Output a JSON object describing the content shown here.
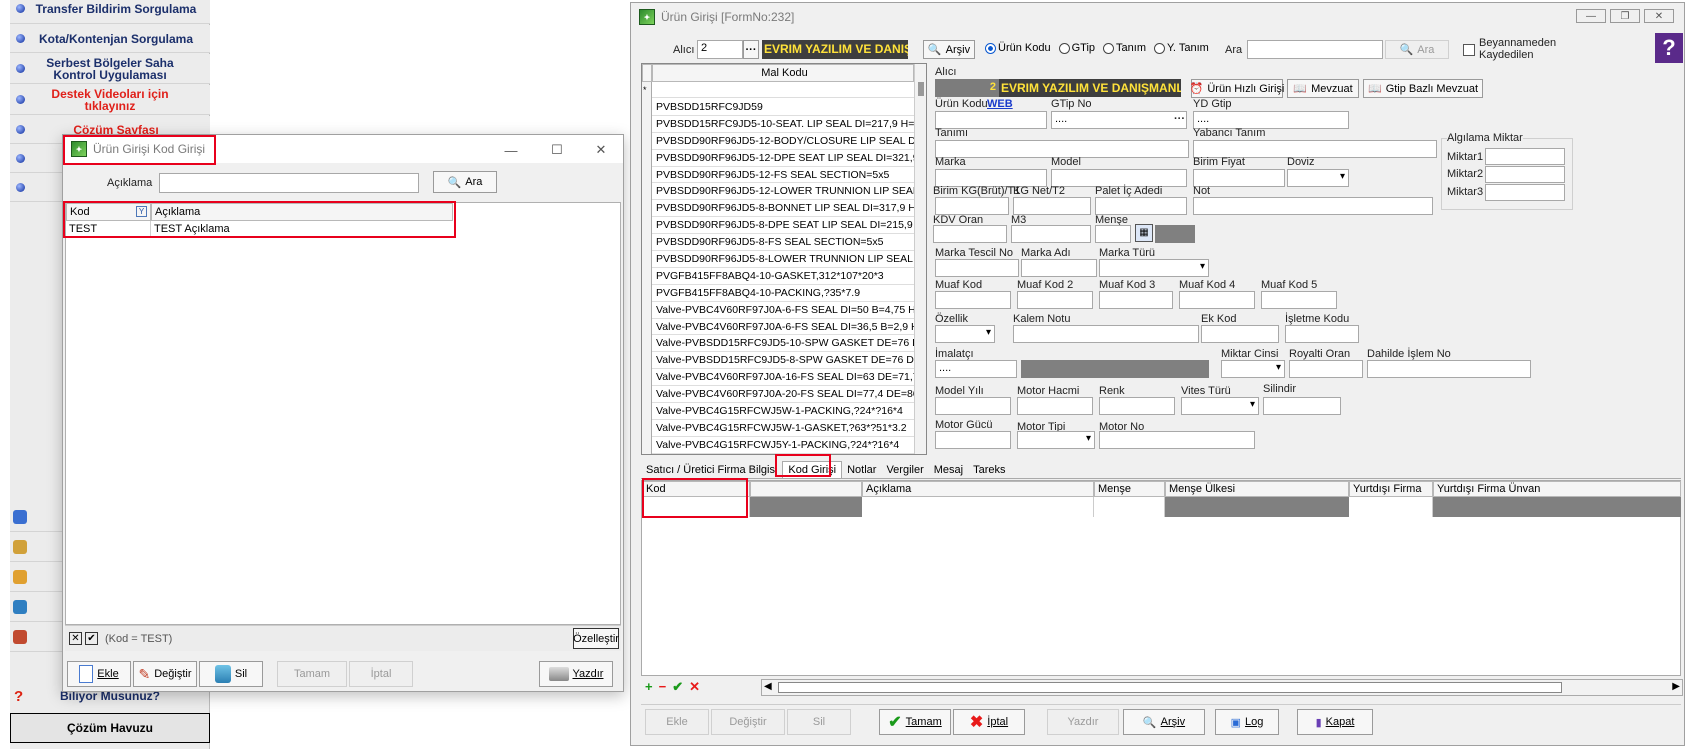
{
  "sidebar": {
    "items": [
      {
        "label": "Transfer Bildirim Sorgulama",
        "red": false
      },
      {
        "label": "Kota/Kontenjan Sorgulama",
        "red": false
      },
      {
        "label": "Serbest Bölgeler Saha Kontrol Uygulaması",
        "red": false
      },
      {
        "label": "Destek Videoları için tıklayınız",
        "red": true
      },
      {
        "label": "Çözüm Sayfası",
        "red": true
      }
    ],
    "biliyor": "Biliyor Musunuz?",
    "cozum_havuzu": "Çözüm Havuzu"
  },
  "kod_dialog": {
    "title": "Ürün Girişi Kod Girişi",
    "aciklama_label": "Açıklama",
    "aciklama_value": "",
    "ara_label": "Ara",
    "columns": [
      "Kod",
      "Açıklama"
    ],
    "rows": [
      {
        "kod": "TEST",
        "aciklama": "TEST Açıklama"
      }
    ],
    "filter_text": "(Kod = TEST)",
    "ozellestir": "Özelleştir",
    "buttons": {
      "ekle": "Ekle",
      "degistir": "Değiştir",
      "sil": "Sil",
      "tamam": "Tamam",
      "iptal": "İptal",
      "yazdir": "Yazdır"
    }
  },
  "main": {
    "title": "Ürün Girişi [FormNo:232]",
    "toolbar": {
      "alici_label": "Alıcı",
      "alici_value": "2",
      "alici_name": "EVRIM YAZILIM VE DANIŞ",
      "arsiv": "Arşiv",
      "radio_options": [
        "Ürün Kodu",
        "GTip",
        "Tanım",
        "Y. Tanım"
      ],
      "radio_selected": 0,
      "ara_label": "Ara",
      "ara_button": "Ara",
      "beyan_label": "Beyannameden Kaydedilen",
      "help": "?"
    },
    "mal_kodu_header": "Mal Kodu",
    "mal_kodu_rows": [
      "PVBSDD15RFC9JD59",
      "PVBSDD15RFC9JD5-10-SEAT. LIP SEAL DI=217,9 H=6,0",
      "PVBSDD90RF96JD5-12-BODY/CLOSURE LIP SEAL DI=4",
      "PVBSDD90RF96JD5-12-DPE SEAT LIP SEAL DI=321,9 H",
      "PVBSDD90RF96JD5-12-FS SEAL SECTION=5x5",
      "PVBSDD90RF96JD5-12-LOWER TRUNNION LIP SEAL D",
      "PVBSDD90RF96JD5-8-BONNET LIP SEAL DI=317,9 H=6",
      "PVBSDD90RF96JD5-8-DPE SEAT LIP SEAL DI=215,9 H=",
      "PVBSDD90RF96JD5-8-FS SEAL SECTION=5x5",
      "PVBSDD90RF96JD5-8-LOWER TRUNNION LIP SEAL DI",
      "PVGFB415FF8ABQ4-10-GASKET,312*107*20*3",
      "PVGFB415FF8ABQ4-10-PACKING,?35*7.9",
      "Valve-PVBC4V60RF97J0A-6-FS SEAL DI=50 B=4,75 H=3,",
      "Valve-PVBC4V60RF97J0A-6-FS SEAL DI=36,5 B=2,9 H=7",
      "Valve-PVBSDD15RFC9JD5-10-SPW GASKET DE=76 DI=",
      "Valve-PVBSDD15RFC9JD5-8-SPW GASKET DE=76 DI=6",
      "Valve-PVBC4V60RF97J0A-16-FS SEAL DI=63 DE=71,7 H",
      "Valve-PVBC4V60RF97J0A-20-FS SEAL DI=77,4 DE=86 H",
      "Valve-PVBC4G15RFCWJ5W-1-PACKING,?24*?16*4",
      "Valve-PVBC4G15RFCWJ5W-1-GASKET,?63*?51*3.2",
      "Valve-PVBC4G15RFCWJ5Y-1-PACKING,?24*?16*4"
    ],
    "form": {
      "alici_label": "Alıcı",
      "alici_no": "2",
      "alici_name": "EVRIM YAZILIM VE DANIŞMANLI",
      "urun_hizli": "Ürün Hızlı Girişi",
      "mevzuat": "Mevzuat",
      "gtip_bazli": "Gtip Bazlı Mevzuat",
      "urun_kodu": "Ürün Kodu",
      "web": "WEB",
      "gtip_no": "GTip No",
      "gtip_value": "....",
      "yd_gtip": "YD Gtip",
      "yd_gtip_value": "....",
      "tanimi": "Tanımı",
      "yabanci_tanim": "Yabancı Tanım",
      "algilama": "Algılama Miktar",
      "miktar1": "Miktar1",
      "miktar2": "Miktar2",
      "miktar3": "Miktar3",
      "marka": "Marka",
      "model": "Model",
      "birim_fiyat": "Birim Fiyat",
      "doviz": "Doviz",
      "birim_kg": "Birim KG(Brüt)/T1",
      "kg_net": "KG Net/T2",
      "palet": "Palet İç Adedi",
      "not": "Not",
      "kdv": "KDV Oran",
      "m3": "M3",
      "mense": "Menşe",
      "marka_tescil": "Marka Tescil No",
      "marka_adi": "Marka Adı",
      "marka_turu": "Marka Türü",
      "muaf1": "Muaf Kod",
      "muaf2": "Muaf Kod 2",
      "muaf3": "Muaf Kod 3",
      "muaf4": "Muaf Kod 4",
      "muaf5": "Muaf Kod 5",
      "ozellik": "Özellik",
      "kalem_notu": "Kalem Notu",
      "ek_kod": "Ek Kod",
      "isletme": "İşletme Kodu",
      "imalatci": "İmalatçı",
      "imalatci_value": "....",
      "miktar_cinsi": "Miktar Cinsi",
      "royalti": "Royalti Oran",
      "dahilde": "Dahilde İşlem No",
      "model_yili": "Model Yılı",
      "motor_hacmi": "Motor Hacmi",
      "renk": "Renk",
      "vites": "Vites Türü",
      "silindir": "Silindir",
      "motor_gucu": "Motor Gücü",
      "motor_tipi": "Motor Tipi",
      "motor_no": "Motor No"
    },
    "tabs": [
      "Satıcı / Üretici Firma Bilgisi",
      "Kod Girişi",
      "Notlar",
      "Vergiler",
      "Mesaj",
      "Tareks"
    ],
    "active_tab": 1,
    "grid_columns": [
      "Kod",
      "",
      "Açıklama",
      "Menşe",
      "Menşe Ülkesi",
      "Yurtdışı Firma",
      "Yurtdışı Firma Ünvan"
    ],
    "bottom": {
      "ekle": "Ekle",
      "degistir": "Değiştir",
      "sil": "Sil",
      "tamam": "Tamam",
      "iptal": "İptal",
      "yazdir": "Yazdır",
      "arsiv": "Arşiv",
      "log": "Log",
      "kapat": "Kapat"
    },
    "mini_icons": [
      "+",
      "−",
      "✔",
      "✕"
    ]
  }
}
